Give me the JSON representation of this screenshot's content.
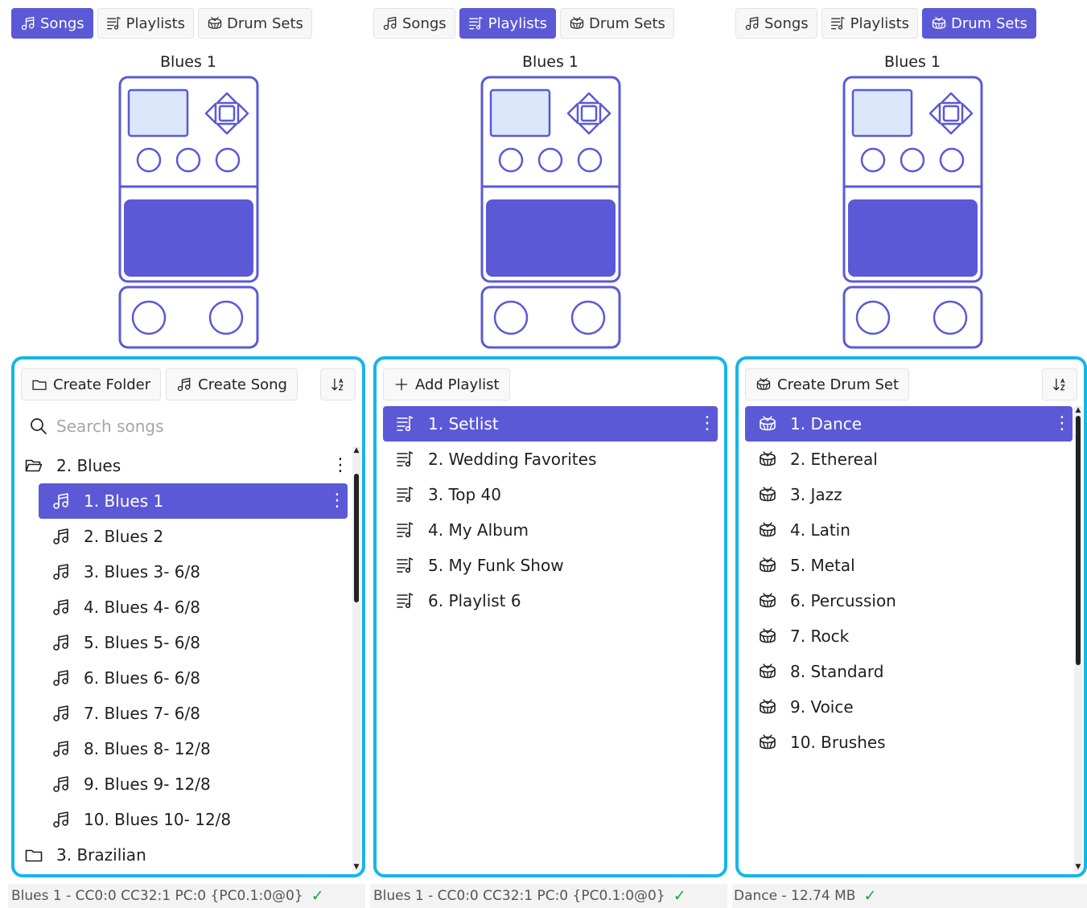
{
  "colors": {
    "accent": "#5b59d6",
    "border": "#16b5e8",
    "ok": "#22a336"
  },
  "tabs": {
    "songs": "Songs",
    "playlists": "Playlists",
    "drum_sets": "Drum Sets"
  },
  "device_title": "Blues 1",
  "songs_panel": {
    "create_folder": "Create Folder",
    "create_song": "Create Song",
    "search_placeholder": "Search songs",
    "folder_blues": "2. Blues",
    "songs": [
      "1. Blues 1",
      "2. Blues 2",
      "3. Blues 3- 6/8",
      "4. Blues 4- 6/8",
      "5. Blues 5- 6/8",
      "6. Blues 6- 6/8",
      "7. Blues 7- 6/8",
      "8. Blues 8- 12/8",
      "9. Blues 9- 12/8",
      "10. Blues 10- 12/8"
    ],
    "folder_brazilian": "3. Brazilian",
    "status": "Blues 1 - CC0:0 CC32:1 PC:0 {PC0.1:0@0}"
  },
  "playlists_panel": {
    "add_playlist": "Add Playlist",
    "playlists": [
      "1. Setlist",
      "2. Wedding Favorites",
      "3. Top 40",
      "4. My Album",
      "5. My Funk Show",
      "6. Playlist 6"
    ],
    "status": "Blues 1 - CC0:0 CC32:1 PC:0 {PC0.1:0@0}"
  },
  "drumsets_panel": {
    "create_drum_set": "Create Drum Set",
    "drum_sets": [
      "1. Dance",
      "2. Ethereal",
      "3. Jazz",
      "4. Latin",
      "5. Metal",
      "6. Percussion",
      "7. Rock",
      "8. Standard",
      "9. Voice",
      "10. Brushes"
    ],
    "status": "Dance - 12.74 MB"
  },
  "status_check": "✓",
  "kebab": "⋮"
}
